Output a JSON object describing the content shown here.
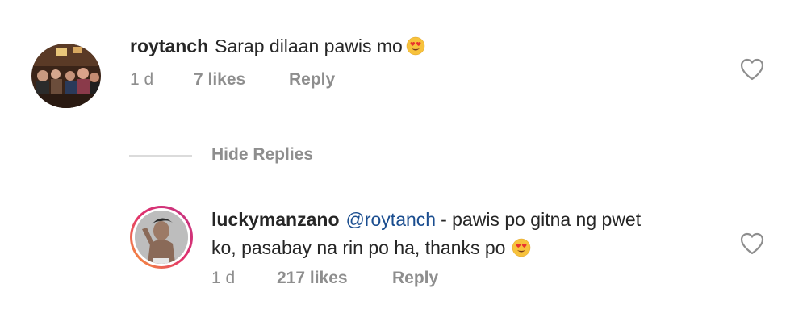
{
  "comment": {
    "username": "roytanch",
    "text": "Sarap dilaan pawis mo",
    "emoji_icon": "heart-eyes-emoji",
    "time": "1 d",
    "likes": "7 likes",
    "reply_label": "Reply"
  },
  "replies_toggle": {
    "label": "Hide Replies"
  },
  "reply": {
    "username": "luckymanzano",
    "mention": "@roytanch",
    "text_line1": "- pawis po gitna ng pwet",
    "text_line2": "ko, pasabay na rin po ha, thanks po",
    "emoji_icon": "heart-eyes-emoji",
    "time": "1 d",
    "likes": "217 likes",
    "reply_label": "Reply"
  },
  "colors": {
    "text": "#262626",
    "secondary": "#8e8e8e",
    "mention": "#1a4d8f",
    "story_ring_start": "#f9a136",
    "story_ring_end": "#c13584"
  }
}
